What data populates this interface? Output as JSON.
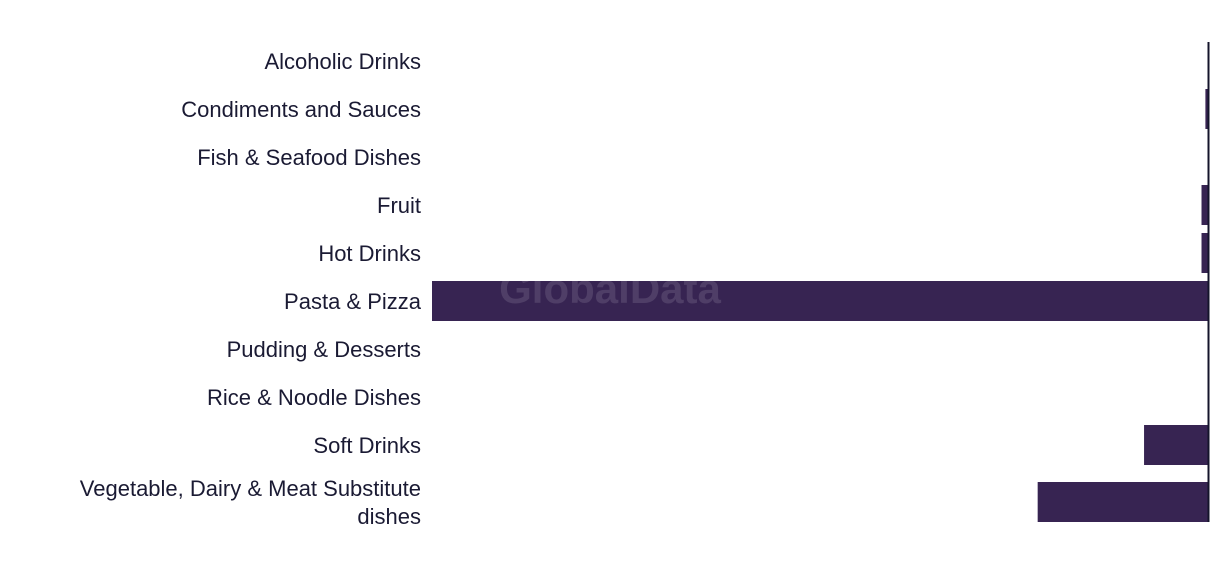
{
  "chart_data": {
    "type": "bar",
    "orientation": "horizontal",
    "direction": "bars extend leftward from right-side axis",
    "categories": [
      "Alcoholic Drinks",
      "Condiments and Sauces",
      "Fish & Seafood Dishes",
      "Fruit",
      "Hot Drinks",
      "Pasta & Pizza",
      "Pudding & Desserts",
      "Rice & Noodle Dishes",
      "Soft Drinks",
      "Vegetable, Dairy & Meat Substitute dishes"
    ],
    "values": [
      0,
      0.4,
      0,
      0.9,
      0.9,
      100,
      0,
      0,
      8.3,
      22
    ],
    "xlim": [
      0,
      100
    ],
    "title": "",
    "xlabel": "",
    "ylabel": "",
    "grid": false,
    "bar_color": "#372452",
    "axis_color": "#14142b",
    "watermark": "GlobalData"
  }
}
